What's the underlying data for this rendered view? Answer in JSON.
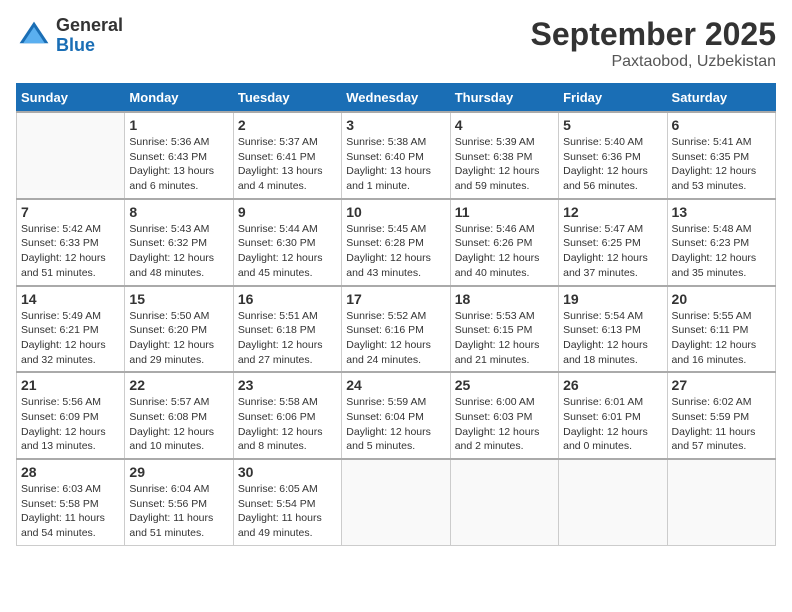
{
  "header": {
    "logo_general": "General",
    "logo_blue": "Blue",
    "month": "September 2025",
    "location": "Paxtaobod, Uzbekistan"
  },
  "days_of_week": [
    "Sunday",
    "Monday",
    "Tuesday",
    "Wednesday",
    "Thursday",
    "Friday",
    "Saturday"
  ],
  "weeks": [
    [
      {
        "day": "",
        "sunrise": "",
        "sunset": "",
        "daylight": ""
      },
      {
        "day": "1",
        "sunrise": "Sunrise: 5:36 AM",
        "sunset": "Sunset: 6:43 PM",
        "daylight": "Daylight: 13 hours and 6 minutes."
      },
      {
        "day": "2",
        "sunrise": "Sunrise: 5:37 AM",
        "sunset": "Sunset: 6:41 PM",
        "daylight": "Daylight: 13 hours and 4 minutes."
      },
      {
        "day": "3",
        "sunrise": "Sunrise: 5:38 AM",
        "sunset": "Sunset: 6:40 PM",
        "daylight": "Daylight: 13 hours and 1 minute."
      },
      {
        "day": "4",
        "sunrise": "Sunrise: 5:39 AM",
        "sunset": "Sunset: 6:38 PM",
        "daylight": "Daylight: 12 hours and 59 minutes."
      },
      {
        "day": "5",
        "sunrise": "Sunrise: 5:40 AM",
        "sunset": "Sunset: 6:36 PM",
        "daylight": "Daylight: 12 hours and 56 minutes."
      },
      {
        "day": "6",
        "sunrise": "Sunrise: 5:41 AM",
        "sunset": "Sunset: 6:35 PM",
        "daylight": "Daylight: 12 hours and 53 minutes."
      }
    ],
    [
      {
        "day": "7",
        "sunrise": "Sunrise: 5:42 AM",
        "sunset": "Sunset: 6:33 PM",
        "daylight": "Daylight: 12 hours and 51 minutes."
      },
      {
        "day": "8",
        "sunrise": "Sunrise: 5:43 AM",
        "sunset": "Sunset: 6:32 PM",
        "daylight": "Daylight: 12 hours and 48 minutes."
      },
      {
        "day": "9",
        "sunrise": "Sunrise: 5:44 AM",
        "sunset": "Sunset: 6:30 PM",
        "daylight": "Daylight: 12 hours and 45 minutes."
      },
      {
        "day": "10",
        "sunrise": "Sunrise: 5:45 AM",
        "sunset": "Sunset: 6:28 PM",
        "daylight": "Daylight: 12 hours and 43 minutes."
      },
      {
        "day": "11",
        "sunrise": "Sunrise: 5:46 AM",
        "sunset": "Sunset: 6:26 PM",
        "daylight": "Daylight: 12 hours and 40 minutes."
      },
      {
        "day": "12",
        "sunrise": "Sunrise: 5:47 AM",
        "sunset": "Sunset: 6:25 PM",
        "daylight": "Daylight: 12 hours and 37 minutes."
      },
      {
        "day": "13",
        "sunrise": "Sunrise: 5:48 AM",
        "sunset": "Sunset: 6:23 PM",
        "daylight": "Daylight: 12 hours and 35 minutes."
      }
    ],
    [
      {
        "day": "14",
        "sunrise": "Sunrise: 5:49 AM",
        "sunset": "Sunset: 6:21 PM",
        "daylight": "Daylight: 12 hours and 32 minutes."
      },
      {
        "day": "15",
        "sunrise": "Sunrise: 5:50 AM",
        "sunset": "Sunset: 6:20 PM",
        "daylight": "Daylight: 12 hours and 29 minutes."
      },
      {
        "day": "16",
        "sunrise": "Sunrise: 5:51 AM",
        "sunset": "Sunset: 6:18 PM",
        "daylight": "Daylight: 12 hours and 27 minutes."
      },
      {
        "day": "17",
        "sunrise": "Sunrise: 5:52 AM",
        "sunset": "Sunset: 6:16 PM",
        "daylight": "Daylight: 12 hours and 24 minutes."
      },
      {
        "day": "18",
        "sunrise": "Sunrise: 5:53 AM",
        "sunset": "Sunset: 6:15 PM",
        "daylight": "Daylight: 12 hours and 21 minutes."
      },
      {
        "day": "19",
        "sunrise": "Sunrise: 5:54 AM",
        "sunset": "Sunset: 6:13 PM",
        "daylight": "Daylight: 12 hours and 18 minutes."
      },
      {
        "day": "20",
        "sunrise": "Sunrise: 5:55 AM",
        "sunset": "Sunset: 6:11 PM",
        "daylight": "Daylight: 12 hours and 16 minutes."
      }
    ],
    [
      {
        "day": "21",
        "sunrise": "Sunrise: 5:56 AM",
        "sunset": "Sunset: 6:09 PM",
        "daylight": "Daylight: 12 hours and 13 minutes."
      },
      {
        "day": "22",
        "sunrise": "Sunrise: 5:57 AM",
        "sunset": "Sunset: 6:08 PM",
        "daylight": "Daylight: 12 hours and 10 minutes."
      },
      {
        "day": "23",
        "sunrise": "Sunrise: 5:58 AM",
        "sunset": "Sunset: 6:06 PM",
        "daylight": "Daylight: 12 hours and 8 minutes."
      },
      {
        "day": "24",
        "sunrise": "Sunrise: 5:59 AM",
        "sunset": "Sunset: 6:04 PM",
        "daylight": "Daylight: 12 hours and 5 minutes."
      },
      {
        "day": "25",
        "sunrise": "Sunrise: 6:00 AM",
        "sunset": "Sunset: 6:03 PM",
        "daylight": "Daylight: 12 hours and 2 minutes."
      },
      {
        "day": "26",
        "sunrise": "Sunrise: 6:01 AM",
        "sunset": "Sunset: 6:01 PM",
        "daylight": "Daylight: 12 hours and 0 minutes."
      },
      {
        "day": "27",
        "sunrise": "Sunrise: 6:02 AM",
        "sunset": "Sunset: 5:59 PM",
        "daylight": "Daylight: 11 hours and 57 minutes."
      }
    ],
    [
      {
        "day": "28",
        "sunrise": "Sunrise: 6:03 AM",
        "sunset": "Sunset: 5:58 PM",
        "daylight": "Daylight: 11 hours and 54 minutes."
      },
      {
        "day": "29",
        "sunrise": "Sunrise: 6:04 AM",
        "sunset": "Sunset: 5:56 PM",
        "daylight": "Daylight: 11 hours and 51 minutes."
      },
      {
        "day": "30",
        "sunrise": "Sunrise: 6:05 AM",
        "sunset": "Sunset: 5:54 PM",
        "daylight": "Daylight: 11 hours and 49 minutes."
      },
      {
        "day": "",
        "sunrise": "",
        "sunset": "",
        "daylight": ""
      },
      {
        "day": "",
        "sunrise": "",
        "sunset": "",
        "daylight": ""
      },
      {
        "day": "",
        "sunrise": "",
        "sunset": "",
        "daylight": ""
      },
      {
        "day": "",
        "sunrise": "",
        "sunset": "",
        "daylight": ""
      }
    ]
  ]
}
